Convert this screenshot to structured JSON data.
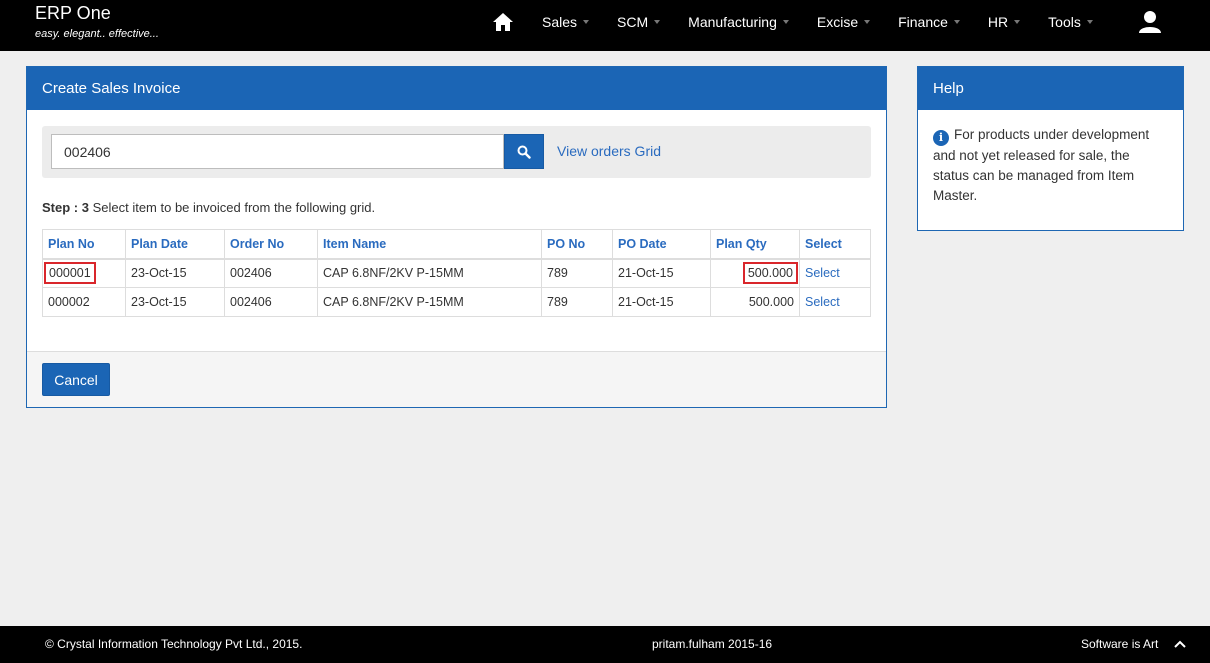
{
  "brand": {
    "title": "ERP One",
    "tagline": "easy. elegant.. effective..."
  },
  "nav": {
    "items": [
      {
        "label": "Sales"
      },
      {
        "label": "SCM"
      },
      {
        "label": "Manufacturing"
      },
      {
        "label": "Excise"
      },
      {
        "label": "Finance"
      },
      {
        "label": "HR"
      },
      {
        "label": "Tools"
      }
    ]
  },
  "main": {
    "title": "Create Sales Invoice",
    "search_value": "002406",
    "view_link": "View orders Grid",
    "step_prefix": "Step : 3",
    "step_text": " Select item to be invoiced from the following grid.",
    "cancel_label": "Cancel"
  },
  "grid": {
    "headers": [
      "Plan No",
      "Plan Date",
      "Order No",
      "Item Name",
      "PO No",
      "PO Date",
      "Plan Qty",
      "Select"
    ],
    "rows": [
      {
        "plan_no": "000001",
        "plan_date": "23-Oct-15",
        "order_no": "002406",
        "item_name": "CAP 6.8NF/2KV P-15MM",
        "po_no": "789",
        "po_date": "21-Oct-15",
        "plan_qty": "500.000",
        "select": "Select"
      },
      {
        "plan_no": "000002",
        "plan_date": "23-Oct-15",
        "order_no": "002406",
        "item_name": "CAP 6.8NF/2KV P-15MM",
        "po_no": "789",
        "po_date": "21-Oct-15",
        "plan_qty": "500.000",
        "select": "Select"
      }
    ]
  },
  "help": {
    "title": "Help",
    "text": "For products under development and not yet released for sale, the status can be managed from Item Master."
  },
  "footer": {
    "copyright": "© Crystal Information Technology Pvt Ltd., 2015.",
    "user": "pritam.fulham 2015-16",
    "slogan": "Software is Art"
  },
  "colors": {
    "accent": "#1b65b5",
    "highlight": "#d9262b",
    "topbar": "#000000"
  },
  "icons": {
    "home": "home-icon",
    "user": "user-icon",
    "search": "search-icon",
    "info": "info-icon",
    "scroll_top": "chevron-up-icon"
  }
}
